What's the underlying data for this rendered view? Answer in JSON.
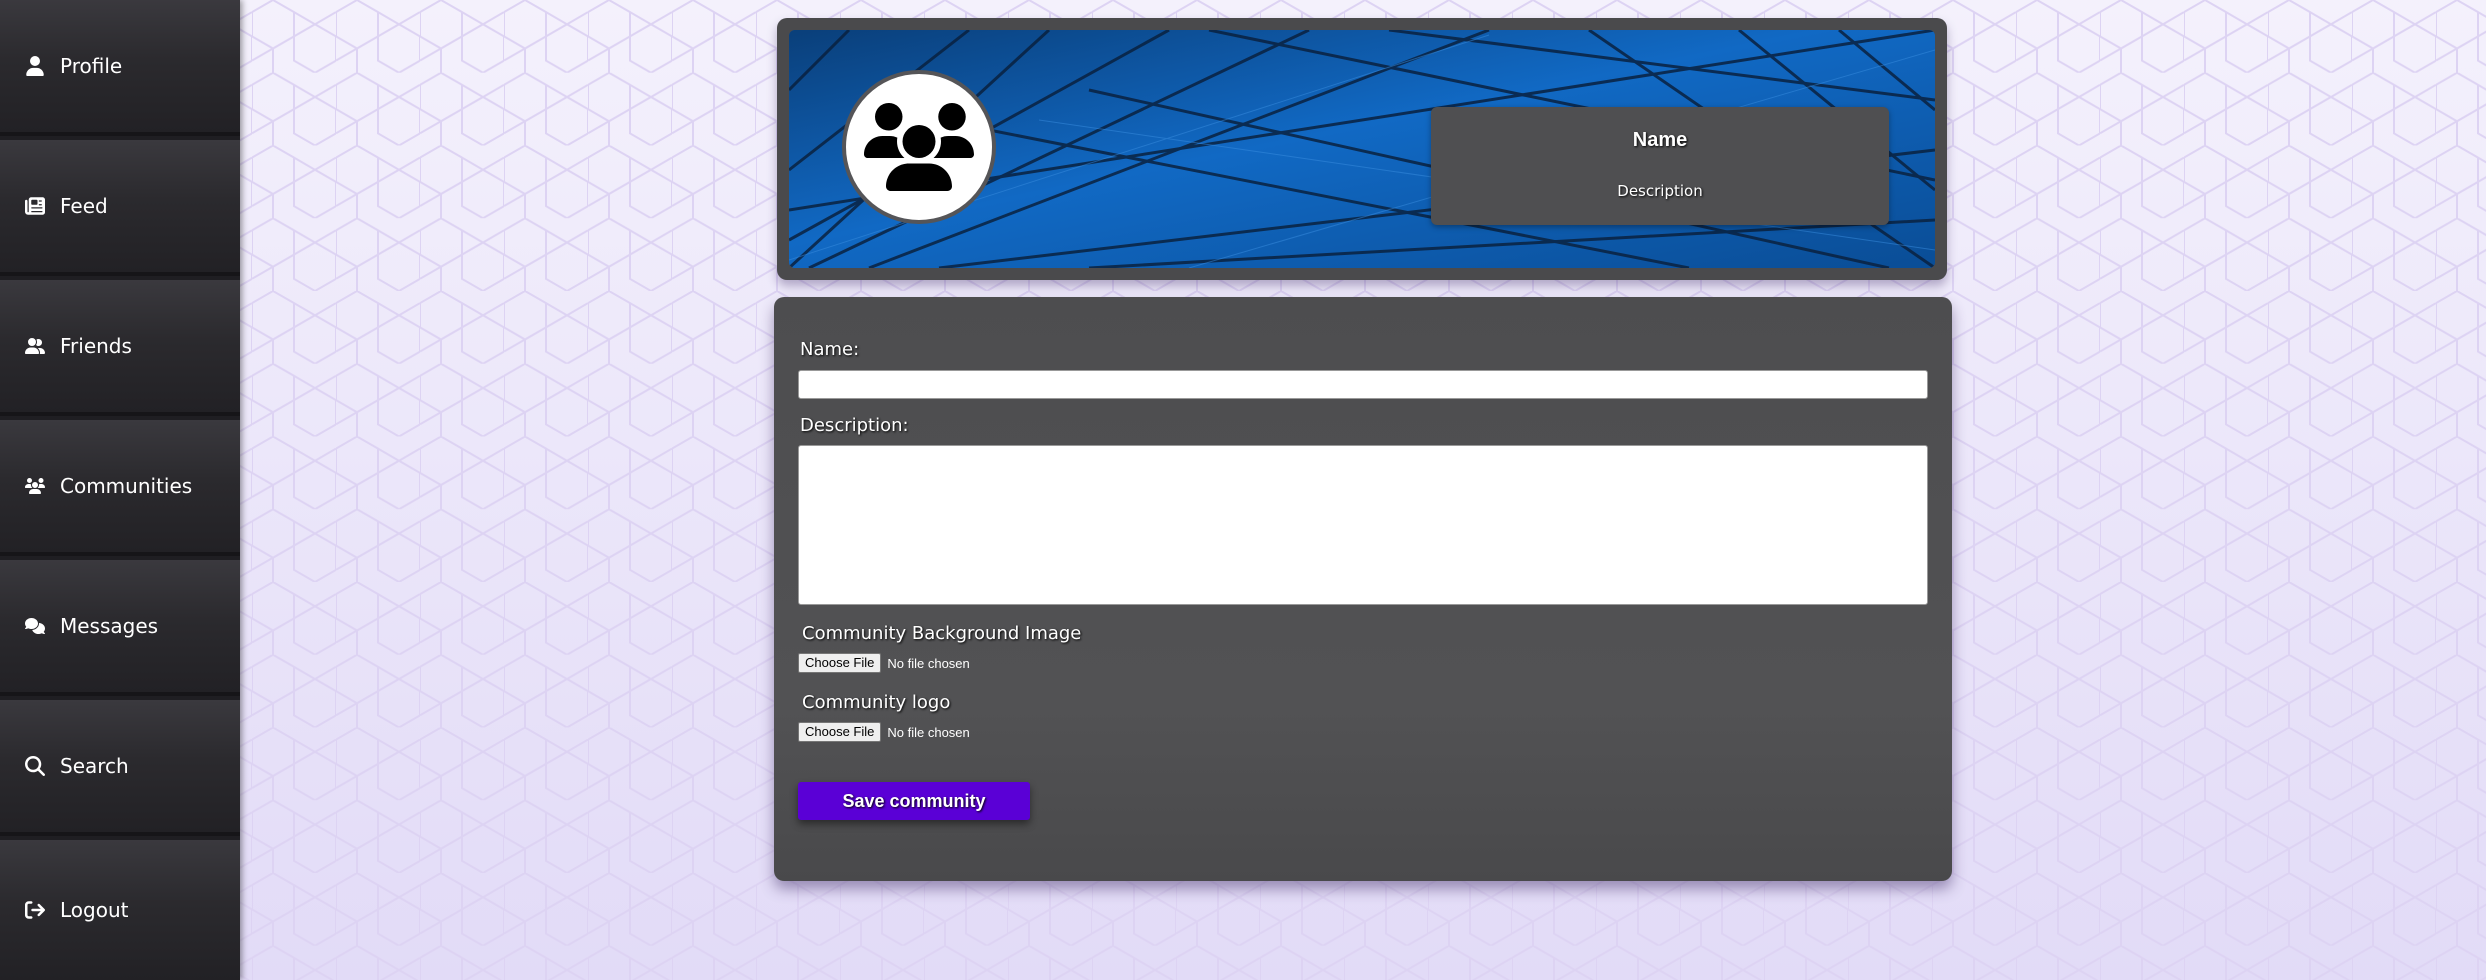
{
  "nav": {
    "items": [
      {
        "label": "Profile",
        "icon": "user-icon"
      },
      {
        "label": "Feed",
        "icon": "newspaper-icon"
      },
      {
        "label": "Friends",
        "icon": "user-friends-icon"
      },
      {
        "label": "Communities",
        "icon": "users-icon"
      },
      {
        "label": "Messages",
        "icon": "comments-icon"
      },
      {
        "label": "Search",
        "icon": "search-icon"
      },
      {
        "label": "Logout",
        "icon": "sign-out-icon"
      }
    ]
  },
  "header": {
    "name": "Name",
    "description": "Description",
    "logo_icon": "community-logo-icon",
    "banner_color": "#0e5ba8"
  },
  "form": {
    "name_label": "Name:",
    "name_value": "",
    "description_label": "Description:",
    "description_value": "",
    "background_label": "Community Background Image",
    "background_button": "Choose File",
    "background_status": "No file chosen",
    "logo_label": "Community logo",
    "logo_button": "Choose File",
    "logo_status": "No file chosen",
    "save_label": "Save community"
  },
  "colors": {
    "accent": "#5a00d6",
    "sidebar": "#2b2a2e",
    "card": "#4f4f51",
    "page_background": "#e8e2f8"
  }
}
